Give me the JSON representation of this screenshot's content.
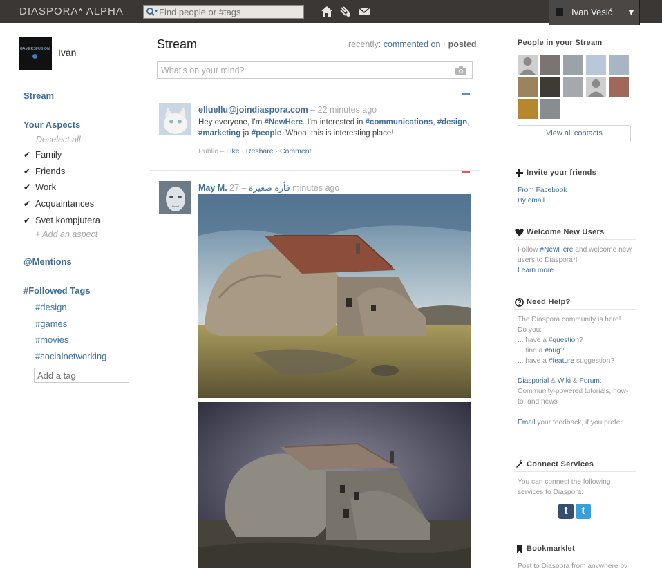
{
  "header": {
    "logo": "DIASPORA* ALPHA",
    "search_placeholder": "Find people or #tags",
    "user_name": "Ivan Vesić",
    "menu_caret": "▼"
  },
  "sidebar": {
    "user_name": "Ivan",
    "avatar_text": "GAMERSFUSION",
    "stream_label": "Stream",
    "aspects_heading": "Your Aspects",
    "deselect_all": "Deselect all",
    "aspects": [
      {
        "label": "Family",
        "check": "✔"
      },
      {
        "label": "Friends",
        "check": "✔"
      },
      {
        "label": "Work",
        "check": "✔"
      },
      {
        "label": "Acquaintances",
        "check": "✔"
      },
      {
        "label": "Svet kompjutera",
        "check": "✔"
      }
    ],
    "add_aspect": "+ Add an aspect",
    "mentions_label": "@Mentions",
    "followed_tags_heading": "#Followed Tags",
    "tags": [
      "#design",
      "#games",
      "#movies",
      "#socialnetworking"
    ],
    "add_tag_placeholder": "Add a tag"
  },
  "stream": {
    "title": "Stream",
    "sort_prefix": "recently:",
    "sort_commented": "commented on",
    "sort_sep": "·",
    "sort_posted": "posted",
    "publisher_placeholder": "What's on your mind?",
    "posts": [
      {
        "author": "elluellu@joindiaspora.com",
        "time": "– 22 minutes ago",
        "body": {
          "p1": "Hey everyone, I'm ",
          "tag1": "#NewHere",
          "p2": ". I'm interested in ",
          "tag2": "#communications",
          "p3": ", ",
          "tag3": "#design",
          "p4": ",",
          "tag4": "#marketing",
          "p5": " ja ",
          "tag5": "#people",
          "p6": ". Whoa, this is interesting place!"
        },
        "meta": {
          "visibility": "Public",
          "dash": "–",
          "like": "Like",
          "dot1": "·",
          "reshare": "Reshare",
          "dot2": "·",
          "comment": "Comment"
        }
      },
      {
        "author": "May M.",
        "time_prefix": "27 –",
        "arabic": "فأرة صغيرة",
        "time_suffix": "minutes ago"
      }
    ]
  },
  "right": {
    "people_heading": "People in your Stream",
    "view_all_contacts": "View all contacts",
    "invite_heading": "Invite your friends",
    "from_facebook": "From Facebook",
    "by_email": "By email",
    "welcome_heading": "Welcome New Users",
    "welcome_follow": "Follow",
    "welcome_tag": "#NewHere",
    "welcome_rest1": " and welcome new",
    "welcome_rest2": "users to Diaspora*!",
    "learn_more": "Learn more",
    "help_heading": "Need Help?",
    "help_line1": "The Diaspora community is here!",
    "help_line2": "Do you:",
    "help_q_pre": "... have a ",
    "help_q_tag": "#question",
    "help_q_post": "?",
    "help_b_pre": "... find a ",
    "help_b_tag": "#bug",
    "help_b_post": "?",
    "help_f_pre": "... have a ",
    "help_f_tag": "#feature",
    "help_f_post": " suggestion?",
    "diasporial": "Diasporial",
    "amp": " & ",
    "wiki": "Wiki",
    "amp2": " & ",
    "forum": "Forum",
    "forum_colon": ":",
    "community_line1": "Community-powered tutorials, how-",
    "community_line2": "to, and news",
    "email_link": "Email",
    "email_rest": " your feedback, if you prefer",
    "connect_heading": "Connect Services",
    "connect_line1": "You can connect the following",
    "connect_line2": "services to Diaspora:",
    "tumblr": "t",
    "twitter": "t",
    "bookmarklet_heading": "Bookmarklet",
    "bookmarklet_text": "Post to Diaspora from anywhere by"
  },
  "colors": {
    "header_bg": "#3a3735",
    "link": "#3f6e9a",
    "muted": "#aaaaaa",
    "hide_blue": "#5b8fc7",
    "hide_red": "#e05a5a",
    "tumblr": "#35506e",
    "twitter": "#3a9fd8"
  },
  "icons": [
    "search-icon",
    "home-icon",
    "notifications-icon",
    "mail-icon",
    "camera-icon",
    "plus-icon",
    "heart-icon",
    "question-icon",
    "wrench-icon",
    "bookmark-icon",
    "checkmark-icon"
  ]
}
